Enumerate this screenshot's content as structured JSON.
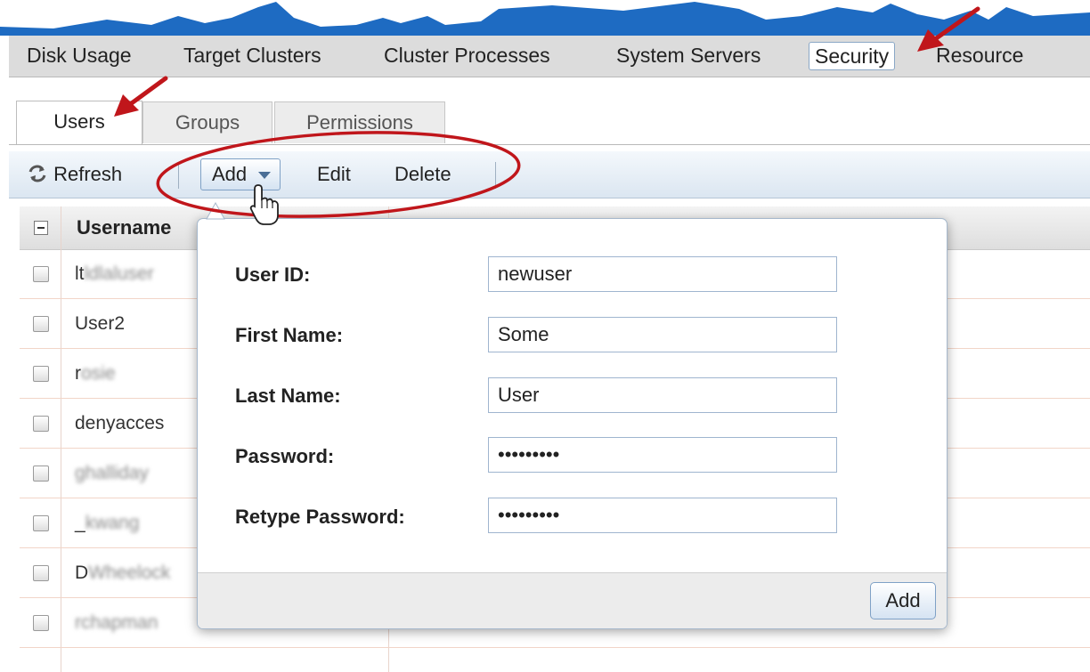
{
  "top_nav": {
    "tabs": [
      {
        "label": "Disk Usage"
      },
      {
        "label": "Target Clusters"
      },
      {
        "label": "Cluster Processes"
      },
      {
        "label": "System Servers"
      },
      {
        "label": "Security",
        "active": true
      },
      {
        "label": "Resource"
      }
    ]
  },
  "sub_tabs": [
    {
      "label": "Users",
      "active": true
    },
    {
      "label": "Groups"
    },
    {
      "label": "Permissions"
    }
  ],
  "toolbar": {
    "refresh_label": "Refresh",
    "add_label": "Add",
    "edit_label": "Edit",
    "delete_label": "Delete"
  },
  "grid": {
    "columns": [
      "Username"
    ],
    "rows": [
      {
        "prefix": "lt",
        "blurred": "ldlaluser"
      },
      {
        "prefix": "User2",
        "blurred": ""
      },
      {
        "prefix": "r",
        "blurred": "osie"
      },
      {
        "prefix": "denyacces",
        "blurred": ""
      },
      {
        "prefix": "",
        "blurred": "ghalliday"
      },
      {
        "prefix": "_",
        "blurred": "kwang"
      },
      {
        "prefix": "D",
        "blurred": "Wheelock"
      },
      {
        "prefix": "",
        "blurred": "rchapman"
      }
    ]
  },
  "add_user_dialog": {
    "fields": [
      {
        "label": "User ID:",
        "value": "newuser",
        "type": "text"
      },
      {
        "label": "First Name:",
        "value": "Some",
        "type": "text"
      },
      {
        "label": "Last Name:",
        "value": "User",
        "type": "text"
      },
      {
        "label": "Password:",
        "value": "xxxxxxxxx",
        "type": "password"
      },
      {
        "label": "Retype Password:",
        "value": "xxxxxxxxx",
        "type": "password"
      }
    ],
    "submit_label": "Add"
  },
  "colors": {
    "accent_blue": "#1e6bc2",
    "annotation_red": "#c0161b",
    "chart_blue": "#1e6bc2"
  },
  "icons": [
    "refresh-icon",
    "caret-down-icon",
    "hand-cursor-icon",
    "red-arrow-icon"
  ]
}
